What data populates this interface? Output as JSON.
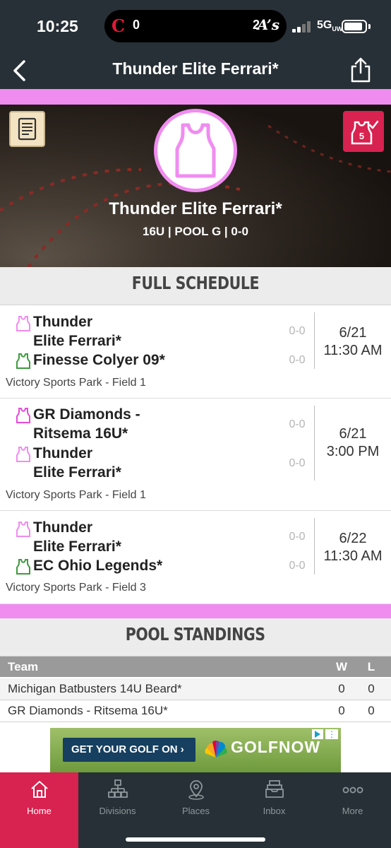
{
  "status_bar": {
    "time": "10:25",
    "left_score": "0",
    "right_score": "2",
    "network": "5G",
    "network_suffix": "UW"
  },
  "nav": {
    "title": "Thunder Elite Ferrari*"
  },
  "hero": {
    "team_name": "Thunder Elite Ferrari*",
    "details": "16U | POOL G | 0-0",
    "badge_number": "5"
  },
  "schedule": {
    "heading": "FULL SCHEDULE",
    "games": [
      {
        "team1": "Thunder Elite Ferrari*",
        "team1_lines": [
          "Thunder",
          "Elite Ferrari*"
        ],
        "team1_score": "0-0",
        "team2": "Finesse Colyer 09*",
        "team2_lines": [
          "Finesse Colyer 09*"
        ],
        "team2_score": "0-0",
        "date": "6/21",
        "time": "11:30 AM",
        "venue": "Victory Sports Park - Field 1"
      },
      {
        "team1": "GR Diamonds - Ritsema 16U*",
        "team1_lines": [
          "GR Diamonds -",
          "Ritsema 16U*"
        ],
        "team1_score": "0-0",
        "team2": "Thunder Elite Ferrari*",
        "team2_lines": [
          "Thunder",
          "Elite Ferrari*"
        ],
        "team2_score": "0-0",
        "date": "6/21",
        "time": "3:00 PM",
        "venue": "Victory Sports Park - Field 1"
      },
      {
        "team1": "Thunder Elite Ferrari*",
        "team1_lines": [
          "Thunder",
          "Elite Ferrari*"
        ],
        "team1_score": "0-0",
        "team2": "EC Ohio Legends*",
        "team2_lines": [
          "EC Ohio Legends*"
        ],
        "team2_score": "0-0",
        "date": "6/22",
        "time": "11:30 AM",
        "venue": "Victory Sports Park - Field 3"
      }
    ]
  },
  "standings": {
    "heading": "POOL STANDINGS",
    "columns": [
      "Team",
      "W",
      "L"
    ],
    "rows": [
      {
        "team": "Michigan Batbusters 14U Beard*",
        "w": "0",
        "l": "0"
      },
      {
        "team": "GR Diamonds - Ritsema 16U*",
        "w": "0",
        "l": "0"
      }
    ]
  },
  "ad": {
    "cta": "GET YOUR GOLF ON ›",
    "brand": "GOLFNOW"
  },
  "tabs": [
    {
      "label": "Home",
      "icon": "home-icon",
      "active": true
    },
    {
      "label": "Divisions",
      "icon": "divisions-icon",
      "active": false
    },
    {
      "label": "Places",
      "icon": "places-icon",
      "active": false
    },
    {
      "label": "Inbox",
      "icon": "inbox-icon",
      "active": false
    },
    {
      "label": "More",
      "icon": "more-icon",
      "active": false
    }
  ],
  "colors": {
    "header_bg": "#273036",
    "accent_pink": "#f08cf0",
    "active_red": "#d8224f",
    "team_icon_green": "#3e9b3e"
  }
}
